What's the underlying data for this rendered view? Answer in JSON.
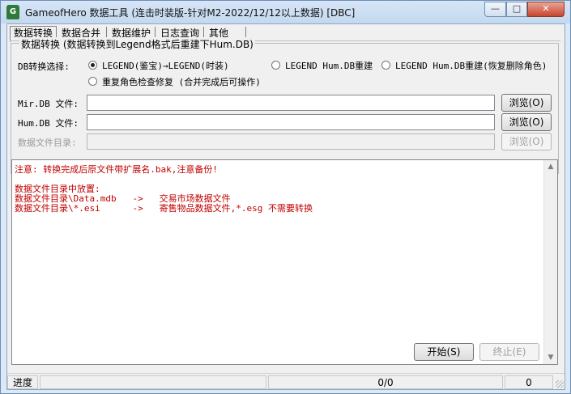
{
  "window": {
    "title": "GameofHero 数据工具 (连击时装版-针对M2-2022/12/12以上数据) [DBC]",
    "minimize_label": "—",
    "maximize_label": "□",
    "close_label": "✕"
  },
  "tabs": [
    "数据转换",
    "数据合并",
    "数据维护",
    "日志查询",
    "其他"
  ],
  "convert_group": {
    "title": "数据转换 (数据转换到Legend格式后重建下Hum.DB)",
    "db_convert_label": "DB转换选择:",
    "options": [
      {
        "label": "LEGEND(鉴宝)→LEGEND(时装)",
        "checked": true
      },
      {
        "label": "LEGEND Hum.DB重建",
        "checked": false
      },
      {
        "label": "LEGEND Hum.DB重建(恢复删除角色)",
        "checked": false
      },
      {
        "label": "重复角色检查修复 (合并完成后可操作)",
        "checked": false
      }
    ],
    "mir_db_label": "Mir.DB  文件:",
    "mir_db_value": "",
    "hum_db_label": "Hum.DB  文件:",
    "hum_db_value": "",
    "data_dir_label": "数据文件目录:",
    "data_dir_value": "",
    "browse_label": "浏览(O)"
  },
  "log": {
    "lines": [
      "注意: 转换完成后原文件带扩展名.bak,注意备份!",
      "",
      "数据文件目录中放置:",
      "数据文件目录\\Data.mdb   ->   交易市场数据文件",
      "数据文件目录\\*.esi      ->   寄售物品数据文件,*.esg 不需要转换"
    ]
  },
  "actions": {
    "start_label": "开始(S)",
    "stop_label": "终止(E)"
  },
  "status": {
    "progress_label": "进度",
    "count": "0/0",
    "value": "0"
  },
  "colors": {
    "log_text": "#c00000",
    "titlebar": "#c3d8ef",
    "close_button": "#c7452f"
  }
}
